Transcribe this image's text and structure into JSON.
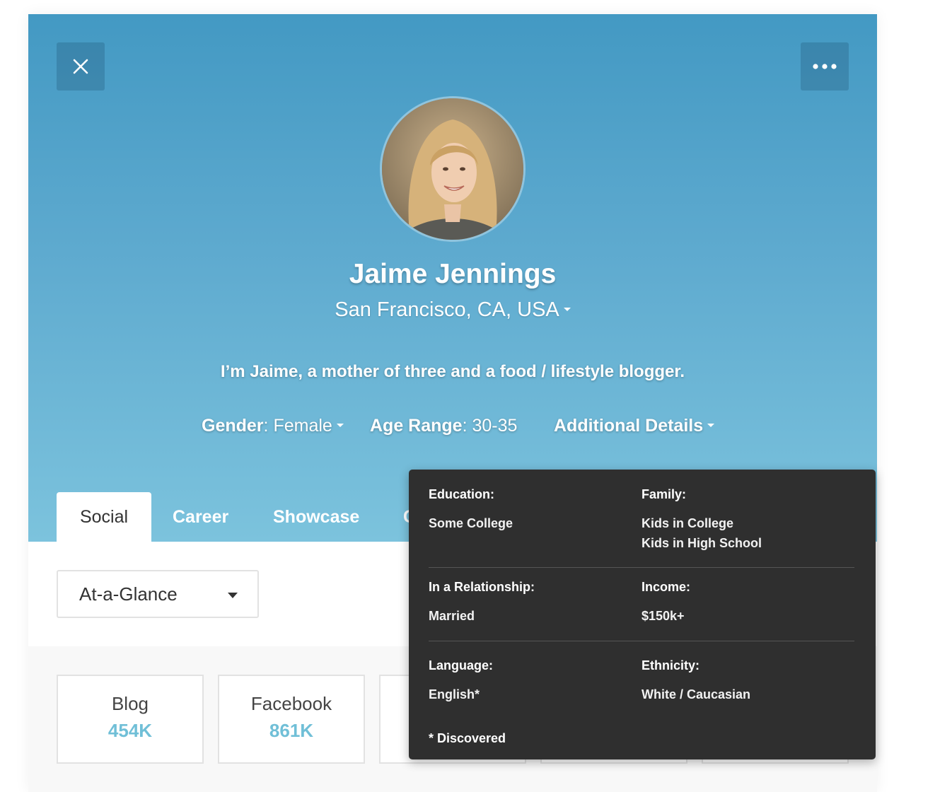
{
  "header": {
    "close_icon": "close-icon",
    "more_icon": "more-horizontal-icon"
  },
  "profile": {
    "name": "Jaime Jennings",
    "location": "San Francisco, CA, USA",
    "bio": "I’m Jaime, a mother of three and a food / lifestyle blogger.",
    "gender_label": "Gender",
    "gender_value": "Female",
    "age_label": "Age Range",
    "age_value": "30-35",
    "additional_label": "Additional Details"
  },
  "tabs": [
    {
      "label": "Social",
      "active": true
    },
    {
      "label": "Career",
      "active": false
    },
    {
      "label": "Showcase",
      "active": false
    },
    {
      "label": "C",
      "active": false
    }
  ],
  "filter": {
    "selected": "At-a-Glance"
  },
  "stats": [
    {
      "label": "Blog",
      "value": "454K"
    },
    {
      "label": "Facebook",
      "value": "861K"
    }
  ],
  "details_popover": {
    "rows": [
      {
        "left": {
          "label": "Education:",
          "values": [
            "Some College"
          ]
        },
        "right": {
          "label": "Family:",
          "values": [
            "Kids in College",
            "Kids in High School"
          ]
        }
      },
      {
        "left": {
          "label": "In a Relationship:",
          "values": [
            "Married"
          ]
        },
        "right": {
          "label": "Income:",
          "values": [
            "$150k+"
          ]
        }
      },
      {
        "left": {
          "label": "Language:",
          "values": [
            "English*"
          ]
        },
        "right": {
          "label": "Ethnicity:",
          "values": [
            "White / Caucasian"
          ]
        }
      }
    ],
    "footnote": "* Discovered"
  },
  "colors": {
    "header_top": "#4399c3",
    "header_bottom": "#7cc3dd",
    "stat_value": "#70bfd7",
    "popover_bg": "#2f2f2f"
  }
}
